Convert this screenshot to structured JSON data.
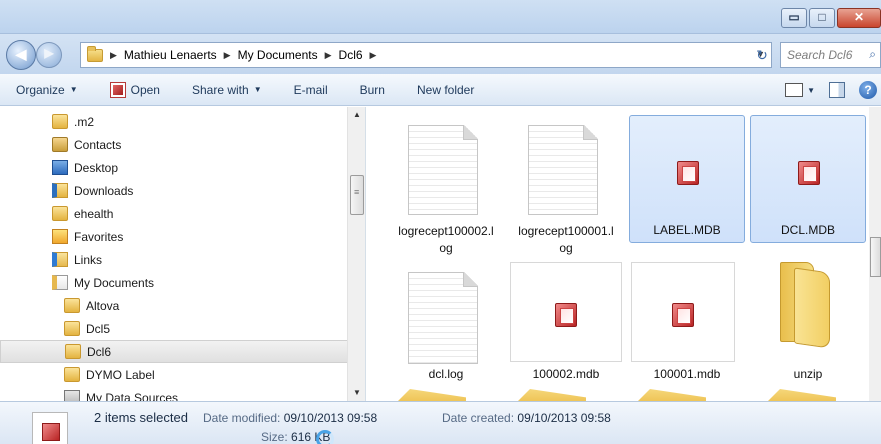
{
  "window": {
    "controls": {
      "minimize": "▭",
      "maximize": "□",
      "close": "✕"
    }
  },
  "address": {
    "back_glyph": "◀",
    "forward_glyph": "▶",
    "crumbs": [
      "Mathieu Lenaerts",
      "My Documents",
      "Dcl6"
    ],
    "separator": "▶",
    "dropdown_glyph": "▼",
    "refresh_glyph": "↻",
    "search_placeholder": "Search Dcl6",
    "search_icon": "⌕"
  },
  "toolbar": {
    "organize": "Organize",
    "open": "Open",
    "share_with": "Share with",
    "email": "E-mail",
    "burn": "Burn",
    "new_folder": "New folder",
    "caret": "▼",
    "help": "?"
  },
  "nav": {
    "items": [
      {
        "label": ".m2",
        "icon": "folder-icon",
        "indent": 0
      },
      {
        "label": "Contacts",
        "icon": "contacts-icon",
        "indent": 0
      },
      {
        "label": "Desktop",
        "icon": "desktop-icon",
        "indent": 0
      },
      {
        "label": "Downloads",
        "icon": "downloads-icon",
        "indent": 0
      },
      {
        "label": "ehealth",
        "icon": "folder-icon",
        "indent": 0
      },
      {
        "label": "Favorites",
        "icon": "favorites-icon",
        "indent": 0
      },
      {
        "label": "Links",
        "icon": "links-icon",
        "indent": 0
      },
      {
        "label": "My Documents",
        "icon": "documents-icon",
        "indent": 0
      },
      {
        "label": "Altova",
        "icon": "folder-icon",
        "indent": 1
      },
      {
        "label": "Dcl5",
        "icon": "folder-icon",
        "indent": 1
      },
      {
        "label": "Dcl6",
        "icon": "folder-icon",
        "indent": 1,
        "selected": true
      },
      {
        "label": "DYMO Label",
        "icon": "folder-icon",
        "indent": 1
      },
      {
        "label": "My Data Sources",
        "icon": "data-sources-icon",
        "indent": 1
      }
    ],
    "scroll_up": "▲",
    "scroll_down": "▼"
  },
  "files": {
    "logrecept100002": {
      "line1": "logrecept100002.l",
      "line2": "og"
    },
    "logrecept100001": {
      "line1": "logrecept100001.l",
      "line2": "og"
    },
    "label_mdb": "LABEL.MDB",
    "dcl_mdb": "DCL.MDB",
    "dcl_log": "dcl.log",
    "mdb_100002": "100002.mdb",
    "mdb_100001": "100001.mdb",
    "unzip": "unzip"
  },
  "details": {
    "count": "2 items selected",
    "modified_label": "Date modified:",
    "modified_value": "09/10/2013 09:58",
    "created_label": "Date created:",
    "created_value": "09/10/2013 09:58",
    "size_label": "Size:",
    "size_value": "616 KB"
  }
}
